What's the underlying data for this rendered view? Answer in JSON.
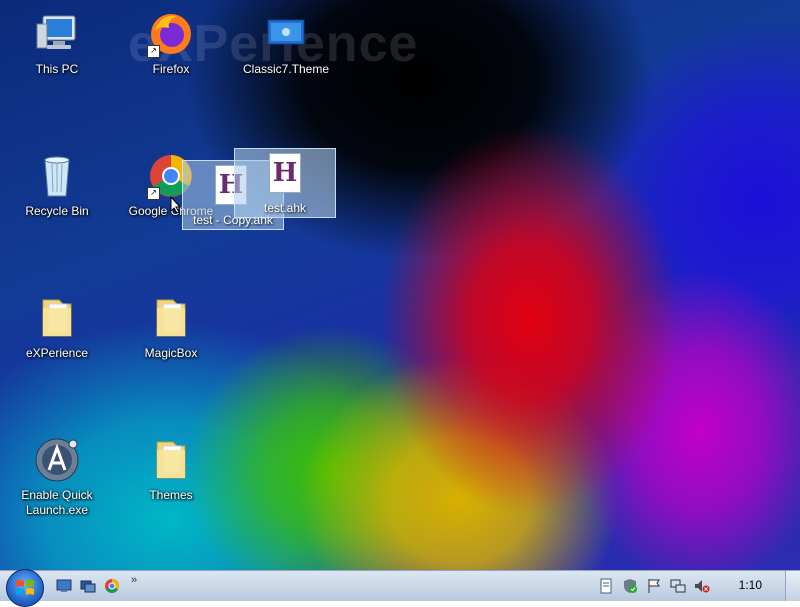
{
  "desktop": {
    "watermark": "eXPerience",
    "icons": [
      {
        "label": "This PC",
        "icon": "computer-icon"
      },
      {
        "label": "Firefox",
        "icon": "firefox-icon"
      },
      {
        "label": "Classic7.Theme",
        "icon": "theme-icon"
      },
      {
        "label": "Recycle Bin",
        "icon": "recycle-bin-icon"
      },
      {
        "label": "Google Chrome",
        "icon": "chrome-icon"
      },
      {
        "label": "eXPerience",
        "icon": "folder-icon"
      },
      {
        "label": "MagicBox",
        "icon": "folder-icon"
      },
      {
        "label": "Enable Quick Launch.exe",
        "icon": "autoit-icon"
      },
      {
        "label": "Themes",
        "icon": "folder-icon"
      }
    ],
    "drag": {
      "copy_label": "test - Copy.ahk",
      "file_label": "test.ahk",
      "file_glyph": "H"
    }
  },
  "taskbar": {
    "quick_launch": [
      "show-desktop-icon",
      "window-switcher-icon",
      "chrome-icon"
    ],
    "more_chevron": "»",
    "tray_icons": [
      "document-icon",
      "shield-icon",
      "flag-icon",
      "network-icon",
      "volume-muted-icon"
    ],
    "clock": "1:10"
  }
}
